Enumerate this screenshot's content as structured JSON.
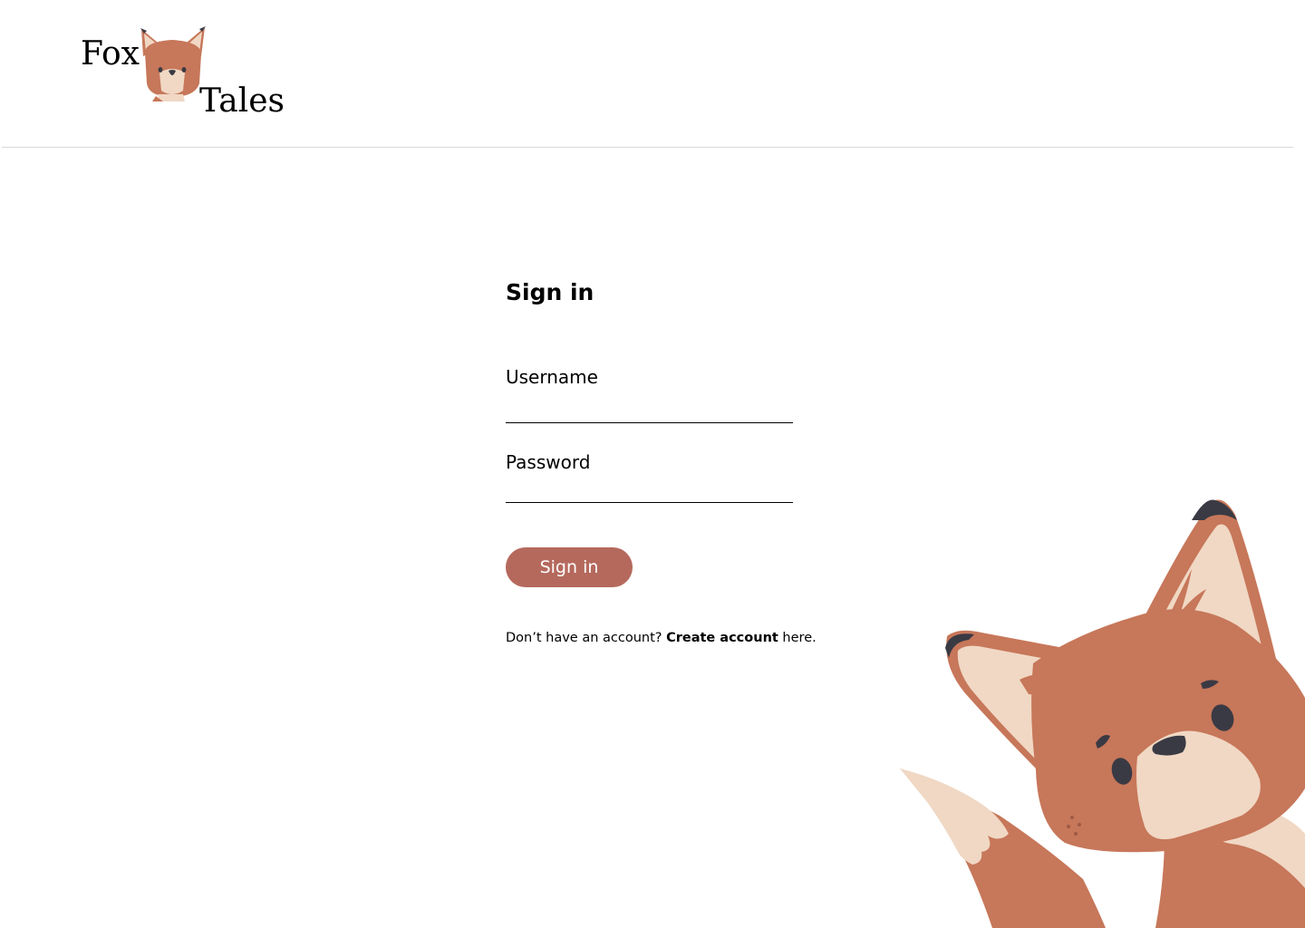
{
  "header": {
    "logo": {
      "word_1": "Fox",
      "word_2": "Tales",
      "icon": "fox-head-icon"
    }
  },
  "signin": {
    "title": "Sign in",
    "username": {
      "label": "Username",
      "value": "",
      "placeholder": ""
    },
    "password": {
      "label": "Password",
      "value": "",
      "placeholder": ""
    },
    "submit_label": "Sign in",
    "create_account": {
      "prefix": "Don’t have an account? ",
      "link_label": "Create account",
      "suffix": " here."
    }
  },
  "illustration": {
    "icon": "fox-mascot-illustration"
  },
  "colors": {
    "accent_button": "#b5695d",
    "fox_fur": "#c7775a",
    "fox_cream": "#f0d8c4",
    "fox_dark": "#3a3a44",
    "divider": "#d9d9d9"
  }
}
